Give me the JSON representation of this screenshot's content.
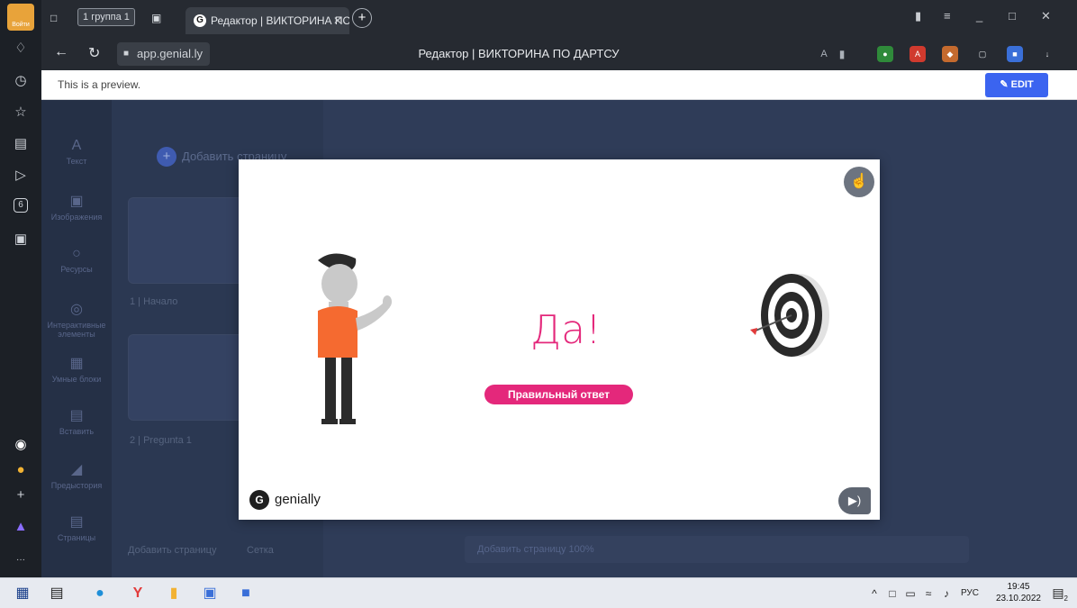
{
  "browser": {
    "login_label": "Войти",
    "tab_group": "группа 1",
    "tab_group_number": "1",
    "active_tab_title": "Редактор | ВИКТОРИНА ПО ДАРТСУ",
    "url": "app.genial.ly",
    "page_title": "Редактор | ВИКТОРИНА ПО ДАРТСУ",
    "rail_badge": "6"
  },
  "preview": {
    "text": "This is a preview.",
    "edit_label": "EDIT"
  },
  "editor": {
    "tools": [
      "Текст",
      "Изображения",
      "Ресурсы",
      "Интерактивные элементы",
      "Умные блоки",
      "Вставить",
      "Предыстория",
      "Страницы"
    ],
    "add_page": "Добавить страницу",
    "pages": [
      "1 | Начало",
      "2 | Pregunta 1"
    ],
    "panel_bottom_add": "Добавить страницу",
    "panel_bottom_grid": "Сетка",
    "bottom_bar": "Добавить страницу   100%"
  },
  "modal": {
    "answer_title": "Да!",
    "answer_badge": "Правильный ответ",
    "brand": "genially"
  },
  "taskbar": {
    "language": "РУС",
    "time": "19:45",
    "date": "23.10.2022",
    "notifications": "2"
  },
  "colors": {
    "accent_pink": "#e4287b",
    "edit_blue": "#3b64f0"
  }
}
